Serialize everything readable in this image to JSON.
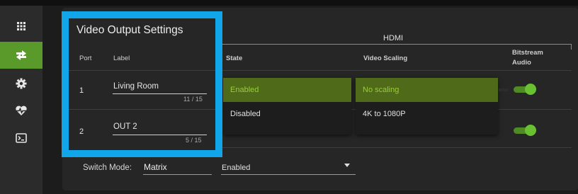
{
  "sidebar": {
    "items": [
      {
        "icon": "grid-icon"
      },
      {
        "icon": "routing-arrows-icon",
        "active": true
      },
      {
        "icon": "gear-icon"
      },
      {
        "icon": "heartbeat-icon"
      },
      {
        "icon": "terminal-icon"
      }
    ]
  },
  "panel": {
    "title": "Video Output Settings",
    "group_header": "HDMI",
    "columns": {
      "port": "Port",
      "label": "Label",
      "state": "State",
      "video_scaling": "Video Scaling",
      "bitstream_line1": "Bitstream",
      "bitstream_line2": "Audio"
    },
    "rows": [
      {
        "port": "1",
        "label": "Living Room",
        "label_count": "11 / 15",
        "bitstream_on": true
      },
      {
        "port": "2",
        "label": "OUT 2",
        "label_count": "5 / 15",
        "bitstream_on": true
      }
    ]
  },
  "state_dropdown": {
    "options": [
      {
        "label": "Enabled",
        "selected": true
      },
      {
        "label": "Disabled",
        "selected": false
      }
    ]
  },
  "scaling_dropdown": {
    "options": [
      {
        "label": "No scaling",
        "selected": true
      },
      {
        "label": "4K to 1080P",
        "selected": false
      }
    ]
  },
  "switch": {
    "label": "Switch Mode:",
    "value": "Matrix",
    "state": "Enabled"
  },
  "colors": {
    "accent_green": "#5a9a2a",
    "highlight_blue": "#11a6ea",
    "selected_option_bg": "#4f6b1a"
  }
}
